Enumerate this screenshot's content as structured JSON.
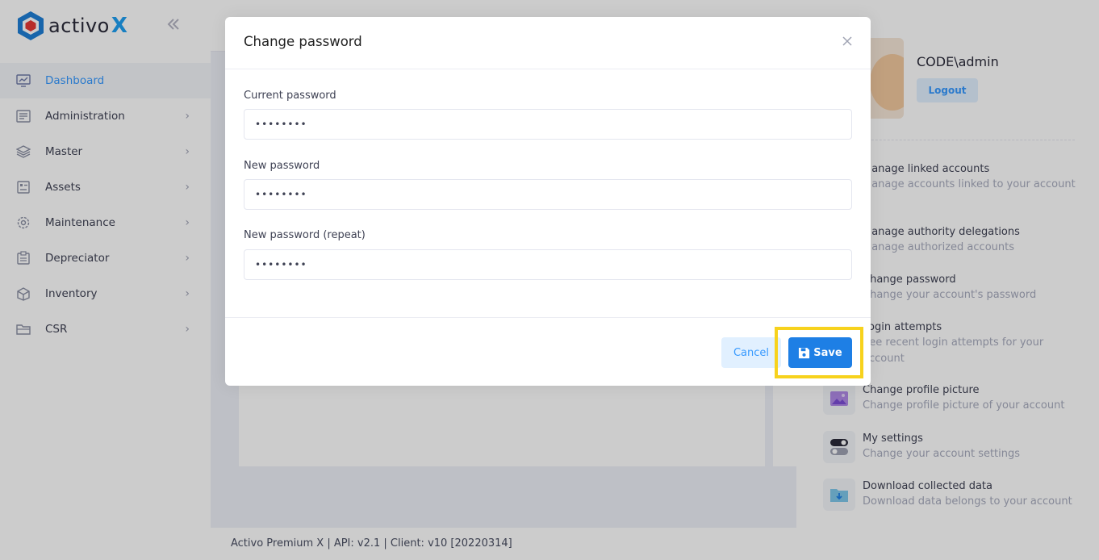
{
  "app": {
    "logo_text": "activo",
    "logo_x": "X"
  },
  "sidebar": {
    "items": [
      {
        "label": "Dashboard",
        "icon": "dashboard-icon",
        "active": true
      },
      {
        "label": "Administration",
        "icon": "administration-icon"
      },
      {
        "label": "Master",
        "icon": "layers-icon"
      },
      {
        "label": "Assets",
        "icon": "assets-icon"
      },
      {
        "label": "Maintenance",
        "icon": "gear-icon"
      },
      {
        "label": "Depreciator",
        "icon": "calculator-icon"
      },
      {
        "label": "Inventory",
        "icon": "box-icon"
      },
      {
        "label": "CSR",
        "icon": "folder-icon"
      }
    ]
  },
  "footer": {
    "text": "Activo Premium X | API: v2.1 | Client: v10 [20220314]"
  },
  "user_panel": {
    "user_name": "CODE\\admin",
    "logout_label": "Logout",
    "menu": [
      {
        "title": "Manage linked accounts",
        "desc": "Manage accounts linked to your account"
      },
      {
        "title": "Manage authority delegations",
        "desc": "Manage authorized accounts"
      },
      {
        "title": "Change password",
        "desc": "Change your account's password"
      },
      {
        "title": "Login attempts",
        "desc": "See recent login attempts for your account"
      },
      {
        "title": "Change profile picture",
        "desc": "Change profile picture of your account"
      },
      {
        "title": "My settings",
        "desc": "Change your account settings"
      },
      {
        "title": "Download collected data",
        "desc": "Download data belongs to your account"
      }
    ]
  },
  "modal": {
    "title": "Change password",
    "fields": [
      {
        "label": "Current password",
        "value": "••••••••"
      },
      {
        "label": "New password",
        "value": "••••••••"
      },
      {
        "label": "New password (repeat)",
        "value": "••••••••"
      }
    ],
    "cancel_label": "Cancel",
    "save_label": "Save"
  },
  "colors": {
    "primary": "#1e7fe5",
    "accent_light": "#e1f0ff",
    "highlight": "#f7d21d"
  }
}
